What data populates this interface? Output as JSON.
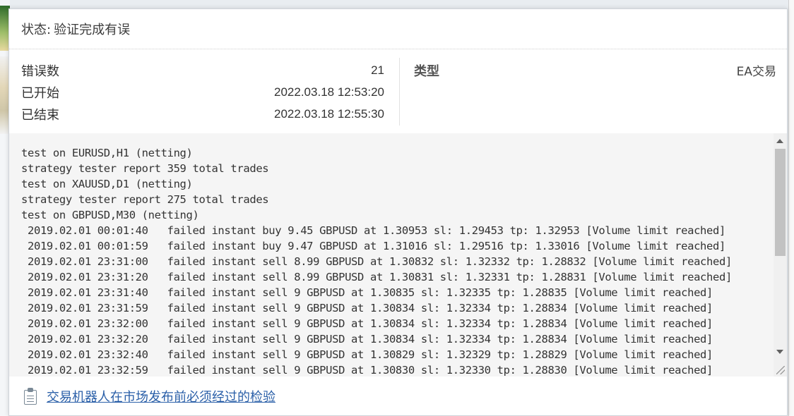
{
  "status": {
    "label": "状态:",
    "value": "验证完成有误"
  },
  "summary": {
    "rows": [
      {
        "label": "错误数",
        "value": "21"
      },
      {
        "label": "已开始",
        "value": "2022.03.18 12:53:20"
      },
      {
        "label": "已结束",
        "value": "2022.03.18 12:55:30"
      }
    ],
    "type_label": "类型",
    "type_value": "EA交易"
  },
  "log": {
    "lines": [
      "test on EURUSD,H1 (netting)",
      "strategy tester report 359 total trades",
      "test on XAUUSD,D1 (netting)",
      "strategy tester report 275 total trades",
      "test on GBPUSD,M30 (netting)",
      " 2019.02.01 00:01:40   failed instant buy 9.45 GBPUSD at 1.30953 sl: 1.29453 tp: 1.32953 [Volume limit reached]",
      " 2019.02.01 00:01:59   failed instant buy 9.47 GBPUSD at 1.31016 sl: 1.29516 tp: 1.33016 [Volume limit reached]",
      " 2019.02.01 23:31:00   failed instant sell 8.99 GBPUSD at 1.30832 sl: 1.32332 tp: 1.28832 [Volume limit reached]",
      " 2019.02.01 23:31:20   failed instant sell 8.99 GBPUSD at 1.30831 sl: 1.32331 tp: 1.28831 [Volume limit reached]",
      " 2019.02.01 23:31:40   failed instant sell 9 GBPUSD at 1.30835 sl: 1.32335 tp: 1.28835 [Volume limit reached]",
      " 2019.02.01 23:31:59   failed instant sell 9 GBPUSD at 1.30834 sl: 1.32334 tp: 1.28834 [Volume limit reached]",
      " 2019.02.01 23:32:00   failed instant sell 9 GBPUSD at 1.30834 sl: 1.32334 tp: 1.28834 [Volume limit reached]",
      " 2019.02.01 23:32:20   failed instant sell 9 GBPUSD at 1.30834 sl: 1.32334 tp: 1.28834 [Volume limit reached]",
      " 2019.02.01 23:32:40   failed instant sell 9 GBPUSD at 1.30829 sl: 1.32329 tp: 1.28829 [Volume limit reached]",
      " 2019.02.01 23:32:59   failed instant sell 9 GBPUSD at 1.30830 sl: 1.32330 tp: 1.28830 [Volume limit reached]"
    ]
  },
  "footer": {
    "icon": "clipboard-icon",
    "link_text": "交易机器人在市场发布前必须经过的检验"
  },
  "colors": {
    "link": "#2a5fa8",
    "log_background": "#f5f5f5",
    "text": "#333333"
  }
}
